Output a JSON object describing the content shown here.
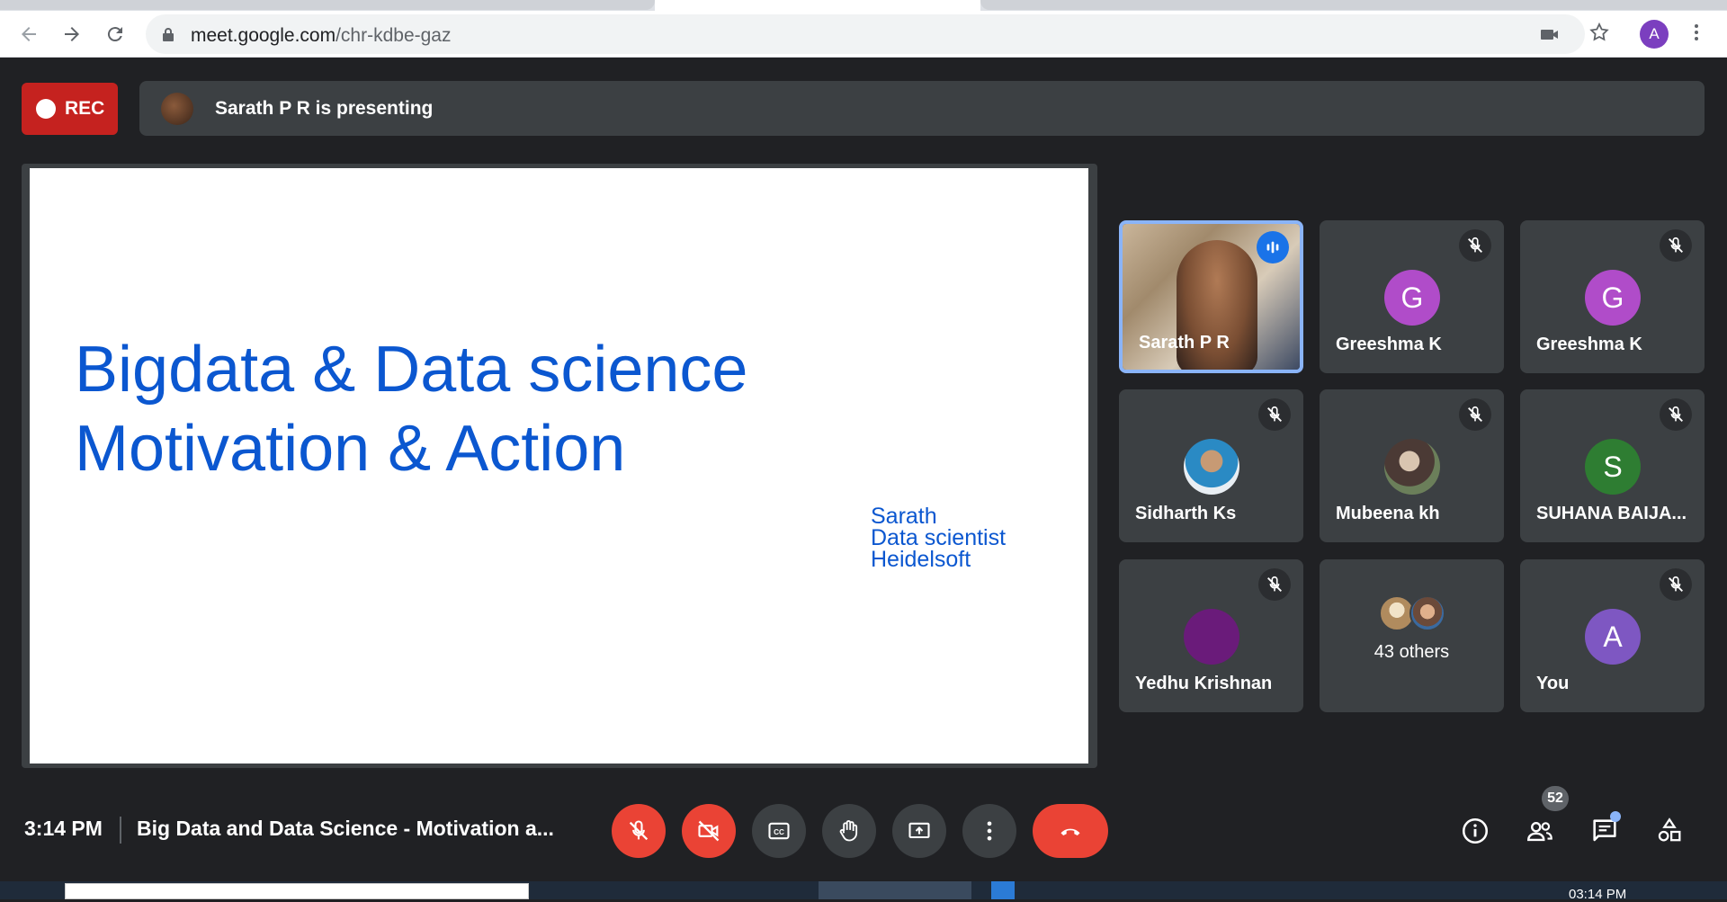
{
  "browser": {
    "url_host": "meet.google.com",
    "url_path": "/chr-kdbe-gaz",
    "profile_initial": "A"
  },
  "meet": {
    "rec_label": "REC",
    "presenting_text": "Sarath P R is presenting",
    "slide": {
      "title_line1": "Bigdata & Data science",
      "title_line2": "Motivation & Action",
      "author": "Sarath",
      "role": "Data scientist",
      "company": "Heidelsoft"
    },
    "tiles": [
      {
        "name": "Sarath P R",
        "type": "video",
        "speaking": true
      },
      {
        "name": "Greeshma K",
        "initial": "G",
        "color": "#b04cc9",
        "muted": true
      },
      {
        "name": "Greeshma K",
        "initial": "G",
        "color": "#b04cc9",
        "muted": true
      },
      {
        "name": "Sidharth Ks",
        "type": "photo",
        "muted": true
      },
      {
        "name": "Mubeena kh",
        "type": "photo",
        "muted": true
      },
      {
        "name": "SUHANA BAIJA...",
        "initial": "S",
        "color": "#2e7d32",
        "muted": true
      },
      {
        "name": "Yedhu Krishnan",
        "initial": "",
        "color": "#6a1b7a",
        "muted": true
      },
      {
        "name": "43 others",
        "type": "others"
      },
      {
        "name": "You",
        "initial": "A",
        "color": "#7e57c2",
        "muted": true
      }
    ],
    "bottom": {
      "time": "3:14 PM",
      "meeting_title": "Big Data and Data Science - Motivation a...",
      "people_count": "52"
    }
  },
  "taskbar": {
    "time": "03:14 PM"
  },
  "colors": {
    "background": "#202124",
    "tile": "#3c4043",
    "rec": "#c5221f",
    "danger": "#ea4335",
    "accent_blue": "#8ab4f8",
    "slide_text": "#0b57d0"
  }
}
